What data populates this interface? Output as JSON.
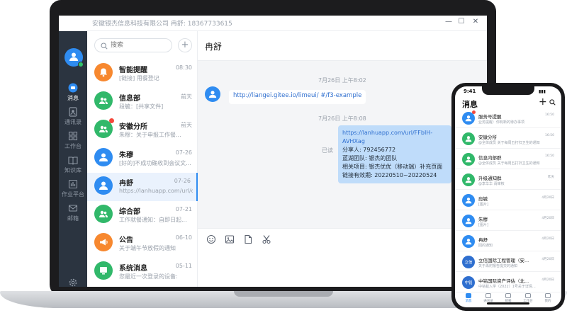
{
  "colors": {
    "accent": "#2f8cf1",
    "nav_bg": "#2b3440",
    "outgoing_bubble": "#bfdcfa",
    "unread_badge": "#f5483b",
    "online": "#31c46b"
  },
  "window": {
    "title": "安徽银杰信息科技有限公司  冉舒: 18367733615",
    "controls": [
      "—",
      "☐",
      "✕"
    ]
  },
  "nav": {
    "items": [
      {
        "label": "消息",
        "icon": "chat-icon",
        "active": true
      },
      {
        "label": "通讯录",
        "icon": "contacts-icon",
        "active": false
      },
      {
        "label": "工作台",
        "icon": "workbench-icon",
        "active": false
      },
      {
        "label": "知识库",
        "icon": "book-icon",
        "active": false
      },
      {
        "label": "作业平台",
        "icon": "chart-icon",
        "active": false
      },
      {
        "label": "邮箱",
        "icon": "mail-icon",
        "active": false
      }
    ],
    "settings_icon": "gear-icon"
  },
  "search": {
    "placeholder": "搜索"
  },
  "conversations": [
    {
      "name": "智能提醒",
      "time": "08:30",
      "preview": "[链接] 用餐登记",
      "color": "#f7882f",
      "icon": "bell-icon"
    },
    {
      "name": "信息部",
      "time": "前天",
      "preview": "段毓：[共享文件]",
      "color": "#31b86a",
      "icon": "group-icon"
    },
    {
      "name": "安徽分所",
      "time": "前天",
      "preview": "朱穆：关于申报工作餐...",
      "color": "#31b86a",
      "icon": "group-icon",
      "unread": true
    },
    {
      "name": "朱穆",
      "time": "07-26",
      "preview": "[好的]不成功确收到会议文...",
      "color": "#2f8cf1",
      "icon": "person-icon"
    },
    {
      "name": "冉舒",
      "time": "07-26",
      "preview": "https://lanhuapp.com/url/q...",
      "color": "#2f8cf1",
      "icon": "person-icon",
      "selected": true
    },
    {
      "name": "综合部",
      "time": "07-21",
      "preview": "工作就餐通知：自即日起...",
      "color": "#31b86a",
      "icon": "group-icon"
    },
    {
      "name": "公告",
      "time": "06-10",
      "preview": "关于端午节放假的通知",
      "color": "#f7882f",
      "icon": "megaphone-icon"
    },
    {
      "name": "系统消息",
      "time": "05-11",
      "preview": "您最近一次登录的设备:",
      "color": "#31b86a",
      "icon": "system-icon"
    }
  ],
  "chat": {
    "title": "冉舒",
    "stamp1": "7月26日   上午8:02",
    "link_message": "http://liangei.gitee.io/limeui/ #/f3-example",
    "stamp2": "7月26日   上午8:08",
    "read_status": "已读",
    "out_lines": [
      "https://lanhuapp.com/url/FFbIH-AVHXag",
      "分享人: 792456772",
      "蓝湖团队: 银杰的团队",
      "相关项目: 银杰优优（移动端）补充页面",
      "链接有效期: 20220510~20220524"
    ],
    "toolbar": [
      "emoji-icon",
      "image-icon",
      "file-icon",
      "scissors-icon"
    ]
  },
  "phone": {
    "time": "9:41",
    "title": "消息",
    "rows": [
      {
        "name": "服务号提醒",
        "preview": "业务提醒：你有新的待办事项",
        "time": "16:50",
        "color": "#2f8cf1",
        "unread": true
      },
      {
        "name": "安徽分所",
        "preview": "@全体成员 关于每周五打扫卫生的通知",
        "time": "16:50",
        "color": "#31b86a"
      },
      {
        "name": "信息内部群",
        "preview": "@全体成员 关于每周五打扫卫生的通知",
        "time": "16:50",
        "color": "#31b86a"
      },
      {
        "name": "升级通知群",
        "preview": "@李华华 请审核",
        "time": "昨天",
        "color": "#31b86a"
      },
      {
        "name": "段毓",
        "preview": "[图片]",
        "time": "4月20日",
        "color": "#2f8cf1"
      },
      {
        "name": "朱穆",
        "preview": "[图片]",
        "time": "4月20日",
        "color": "#2f8cf1"
      },
      {
        "name": "冉舒",
        "preview": "回的通知",
        "time": "4月20日",
        "color": "#2f8cf1"
      },
      {
        "name": "立信国际工程管理（安...",
        "preview": "关于再附报告提交的通知",
        "time": "4月20日",
        "color": "#2f6fcf",
        "avatar_text": "立信"
      },
      {
        "name": "中铭国际资产评估（北...",
        "preview": "中铭载入学（2022）1号关于详情...",
        "time": "4月20日",
        "color": "#2f6fcf",
        "avatar_text": "中铭"
      }
    ],
    "tabs": [
      "消息",
      "通讯录",
      "邮箱",
      "工作台",
      "我的"
    ]
  }
}
